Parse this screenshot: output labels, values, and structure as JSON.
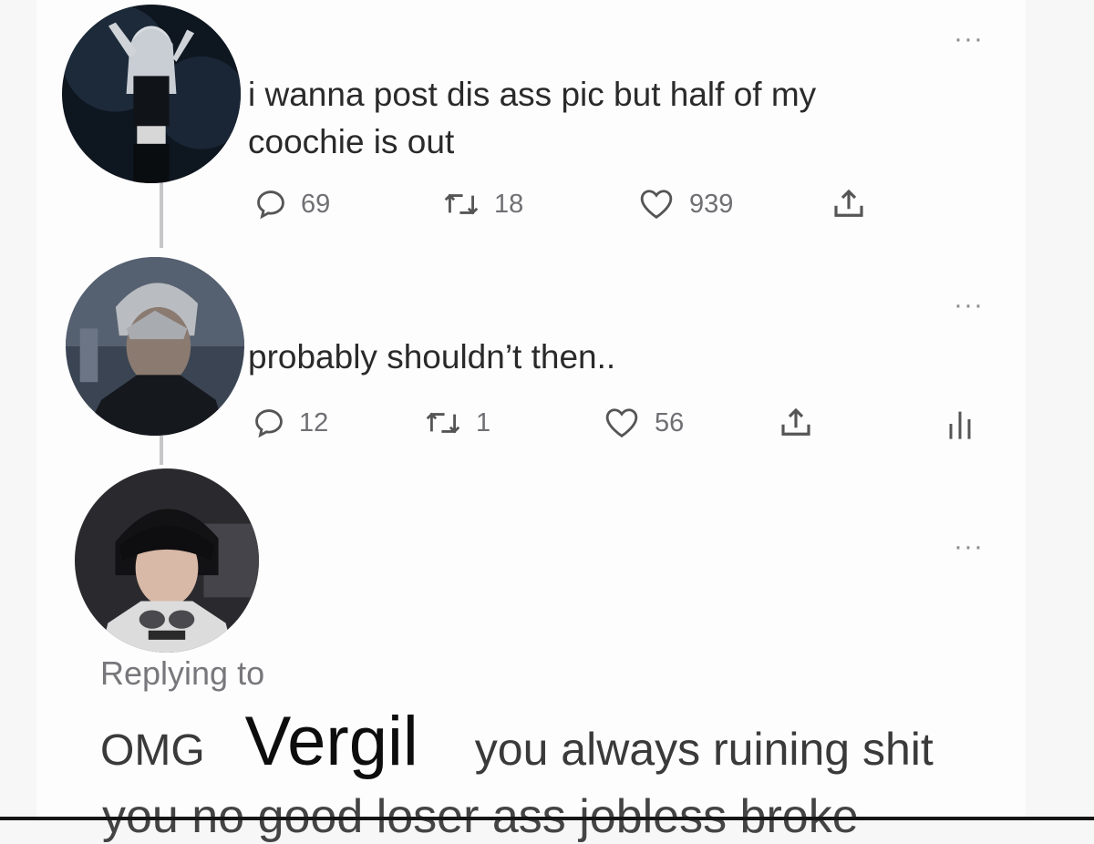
{
  "tweets": [
    {
      "text_line1": "i wanna post dis ass pic but half of my",
      "text_line2": "coochie is out",
      "replies": "69",
      "retweets": "18",
      "likes": "939"
    },
    {
      "text_line1": "probably shouldn’t then..",
      "replies": "12",
      "retweets": "1",
      "likes": "56"
    }
  ],
  "reply": {
    "replying_to_label": "Replying to",
    "prefix": "OMG",
    "mention": "Vergil",
    "rest": "you always ruining shit",
    "cutoff_line": "you no good loser ass jobless broke"
  },
  "icons": {
    "reply": "speech-bubble-icon",
    "retweet": "retweet-icon",
    "like": "heart-icon",
    "share": "share-icon",
    "analytics": "analytics-icon",
    "more": "more-options-icon"
  },
  "colors": {
    "background": "#fdfdfd",
    "text": "#2a2a2a",
    "muted": "#6f6f74",
    "thread_line": "#c6c6c8"
  }
}
